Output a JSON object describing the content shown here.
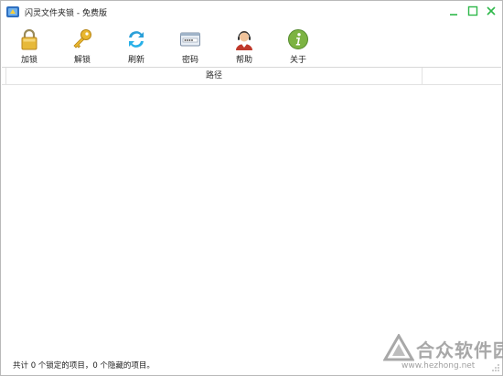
{
  "window": {
    "title": "闪灵文件夹锁 - 免费版",
    "accent": "#2fb84a"
  },
  "toolbar": {
    "items": [
      {
        "label": "加锁",
        "icon": "padlock-icon"
      },
      {
        "label": "解锁",
        "icon": "key-icon"
      },
      {
        "label": "刷新",
        "icon": "refresh-icon"
      },
      {
        "label": "密码",
        "icon": "password-card-icon"
      },
      {
        "label": "帮助",
        "icon": "support-agent-icon"
      },
      {
        "label": "关于",
        "icon": "info-icon"
      }
    ]
  },
  "list": {
    "columns": [
      "路径"
    ],
    "rows": []
  },
  "status": {
    "text": "共计 0 个锁定的项目，0 个隐藏的项目。"
  },
  "watermark": {
    "brand": "合众软件园",
    "url": "www.hezhong.net"
  }
}
